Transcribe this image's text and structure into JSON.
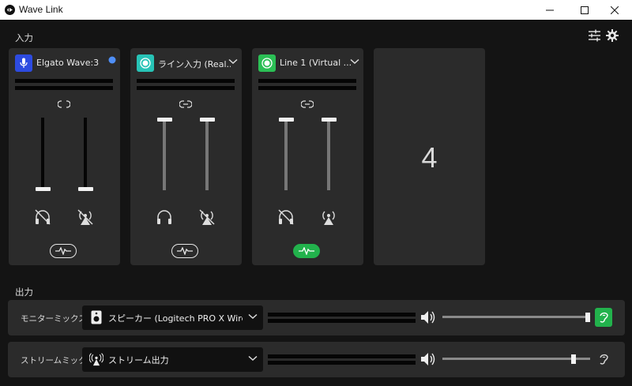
{
  "window": {
    "title": "Wave Link",
    "app_icon": "wave-link-logo",
    "controls": [
      "minimize-icon",
      "maximize-icon",
      "close-icon"
    ]
  },
  "input_section": {
    "label": "入力",
    "tools": [
      "mixer-settings-icon",
      "gear-icon"
    ],
    "channels": [
      {
        "name": "Elgato Wave:3",
        "icon": "microphone-icon",
        "icon_color": "#2d4be0",
        "has_dropdown": false,
        "status_dot_color": "#4f8ff7",
        "link_state": "unlinked",
        "monitor_mute": "muted",
        "stream_mute": "muted",
        "monitor_level": 0.0,
        "stream_level": 0.0,
        "effects_active": false
      },
      {
        "name": "ライン入力 (Real...",
        "icon": "line-input-icon",
        "icon_color": "#27c3b6",
        "has_dropdown": true,
        "link_state": "linked",
        "monitor_mute": "on",
        "stream_mute": "muted",
        "monitor_level": 1.0,
        "stream_level": 1.0,
        "effects_active": false
      },
      {
        "name": "Line 1 (Virtual ...",
        "icon": "line-input-icon",
        "icon_color": "#2bbf55",
        "has_dropdown": true,
        "link_state": "linked",
        "monitor_mute": "muted",
        "stream_mute": "on",
        "monitor_level": 1.0,
        "stream_level": 1.0,
        "effects_active": true
      }
    ],
    "empty_slot_label": "4"
  },
  "output_section": {
    "label": "出力",
    "rows": [
      {
        "label": "モニターミックス",
        "device": "スピーカー (Logitech PRO X Wireles...",
        "device_icon": "speaker-icon",
        "volume_level": 1.0,
        "listen_active": true
      },
      {
        "label": "ストリームミックス",
        "device": "ストリーム出力",
        "device_icon": "broadcast-icon",
        "volume_level": 0.88,
        "listen_active": false
      }
    ]
  },
  "colors": {
    "accent_green": "#22b24c",
    "background": "#141414",
    "panel": "#2b2b2b"
  }
}
